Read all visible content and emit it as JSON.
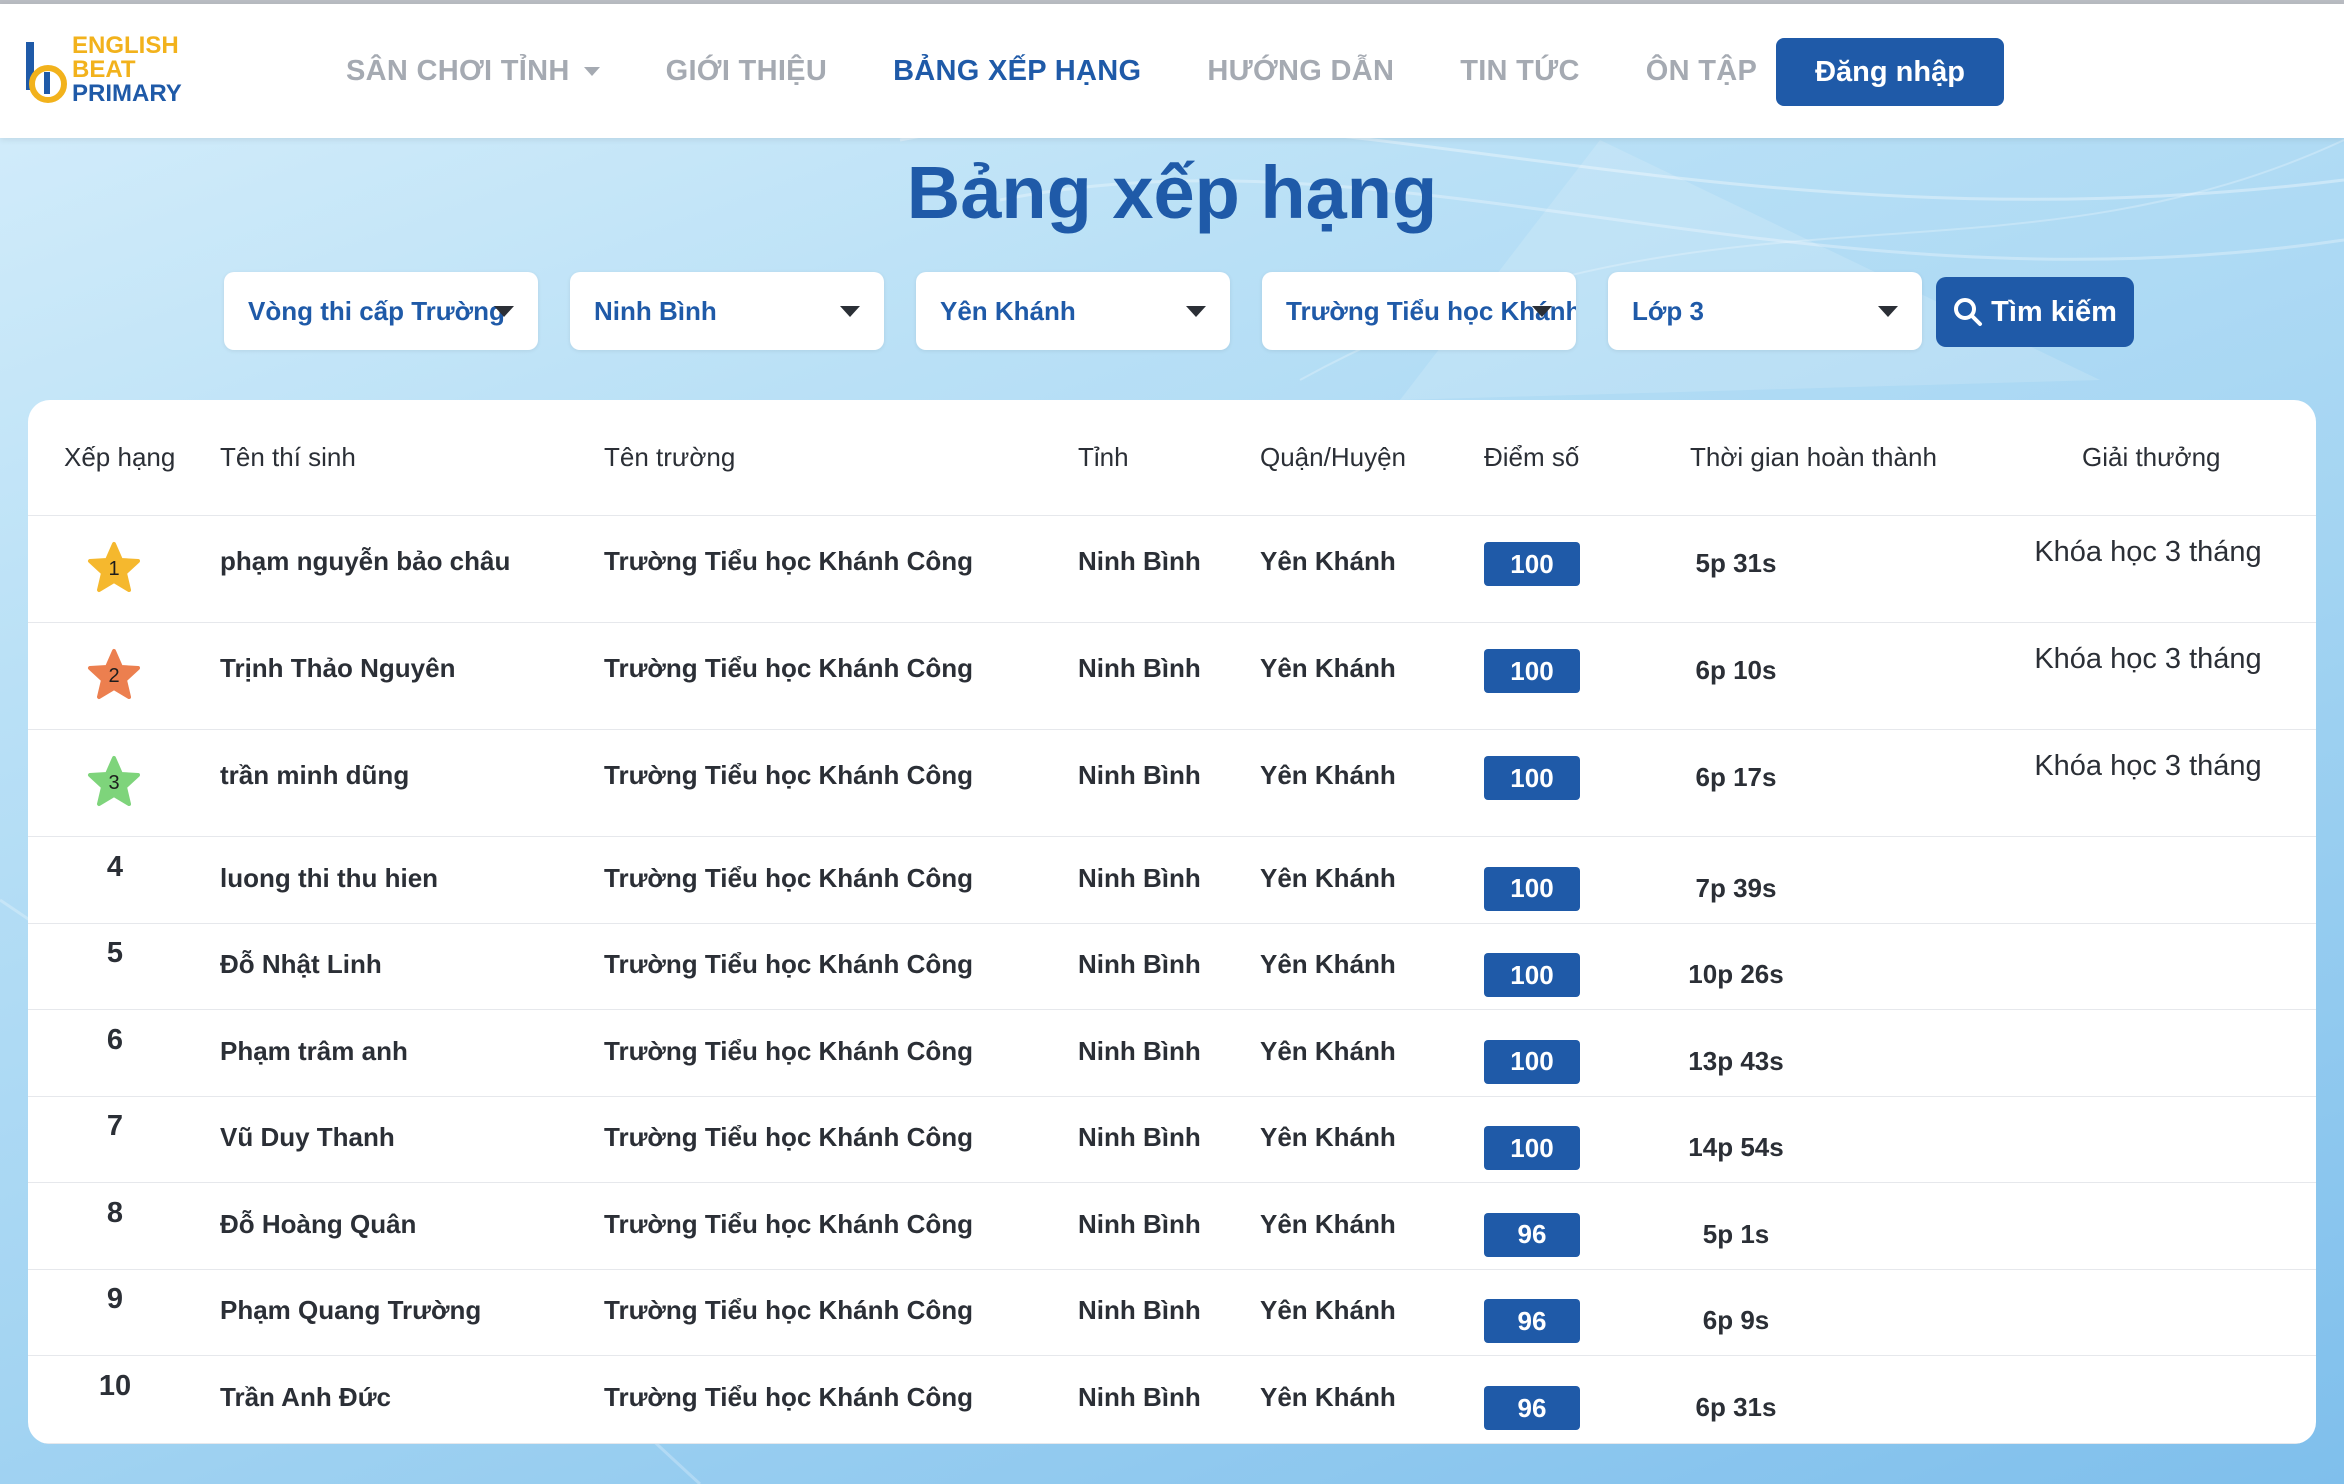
{
  "logo": {
    "line1": "ENGLISH",
    "line2": "BEAT",
    "line3": "PRIMARY"
  },
  "nav": {
    "items": [
      {
        "label": "SÂN CHƠI TỈNH",
        "has_dropdown": true,
        "active": false
      },
      {
        "label": "GIỚI THIỆU",
        "active": false
      },
      {
        "label": "BẢNG XẾP HẠNG",
        "active": true
      },
      {
        "label": "HƯỚNG DẪN",
        "active": false
      },
      {
        "label": "TIN TỨC",
        "active": false
      },
      {
        "label": "ÔN TẬP",
        "active": false
      }
    ],
    "login_label": "Đăng nhập"
  },
  "page_title": "Bảng xếp hạng",
  "filters": [
    {
      "label": "Vòng thi cấp Trường"
    },
    {
      "label": "Ninh Bình"
    },
    {
      "label": "Yên Khánh"
    },
    {
      "label": "Trường Tiểu học Khánh"
    },
    {
      "label": "Lớp 3"
    }
  ],
  "search_label": "Tìm kiếm",
  "table": {
    "headers": [
      "Xếp hạng",
      "Tên thí sinh",
      "Tên trường",
      "Tỉnh",
      "Quận/Huyện",
      "Điểm số",
      "Thời gian hoàn thành",
      "Giải thưởng"
    ],
    "rows": [
      {
        "rank": "1",
        "name": "phạm nguyễn bảo châu",
        "school": "Trường Tiểu học Khánh Công",
        "province": "Ninh Bình",
        "district": "Yên Khánh",
        "score": "100",
        "time": "5p 31s",
        "prize": "Khóa học 3 tháng"
      },
      {
        "rank": "2",
        "name": "Trịnh Thảo Nguyên",
        "school": "Trường Tiểu học Khánh Công",
        "province": "Ninh Bình",
        "district": "Yên Khánh",
        "score": "100",
        "time": "6p 10s",
        "prize": "Khóa học 3 tháng"
      },
      {
        "rank": "3",
        "name": "trần minh dũng",
        "school": "Trường Tiểu học Khánh Công",
        "province": "Ninh Bình",
        "district": "Yên Khánh",
        "score": "100",
        "time": "6p 17s",
        "prize": "Khóa học 3 tháng"
      },
      {
        "rank": "4",
        "name": "luong thi thu hien",
        "school": "Trường Tiểu học Khánh Công",
        "province": "Ninh Bình",
        "district": "Yên Khánh",
        "score": "100",
        "time": "7p 39s",
        "prize": ""
      },
      {
        "rank": "5",
        "name": "Đỗ Nhật Linh",
        "school": "Trường Tiểu học Khánh Công",
        "province": "Ninh Bình",
        "district": "Yên Khánh",
        "score": "100",
        "time": "10p 26s",
        "prize": ""
      },
      {
        "rank": "6",
        "name": "Phạm trâm anh",
        "school": "Trường Tiểu học Khánh Công",
        "province": "Ninh Bình",
        "district": "Yên Khánh",
        "score": "100",
        "time": "13p 43s",
        "prize": ""
      },
      {
        "rank": "7",
        "name": "Vũ Duy Thanh",
        "school": "Trường Tiểu học Khánh Công",
        "province": "Ninh Bình",
        "district": "Yên Khánh",
        "score": "100",
        "time": "14p 54s",
        "prize": ""
      },
      {
        "rank": "8",
        "name": "Đỗ Hoàng Quân",
        "school": "Trường Tiểu học Khánh Công",
        "province": "Ninh Bình",
        "district": "Yên Khánh",
        "score": "96",
        "time": "5p 1s",
        "prize": ""
      },
      {
        "rank": "9",
        "name": "Phạm Quang Trường",
        "school": "Trường Tiểu học Khánh Công",
        "province": "Ninh Bình",
        "district": "Yên Khánh",
        "score": "96",
        "time": "6p 9s",
        "prize": ""
      },
      {
        "rank": "10",
        "name": "Trần Anh Đức",
        "school": "Trường Tiểu học Khánh Công",
        "province": "Ninh Bình",
        "district": "Yên Khánh",
        "score": "96",
        "time": "6p 31s",
        "prize": ""
      }
    ]
  },
  "colors": {
    "primary": "#1f5aa8",
    "logo_yellow": "#f2b21c",
    "nav_inactive": "#a5aab2",
    "star_gold": "#f5b82e",
    "star_orange": "#ec7f4f",
    "star_green": "#7ed47b"
  },
  "icons": {
    "search": "search-icon",
    "star": "star-icon",
    "caret": "chevron-down-icon"
  }
}
